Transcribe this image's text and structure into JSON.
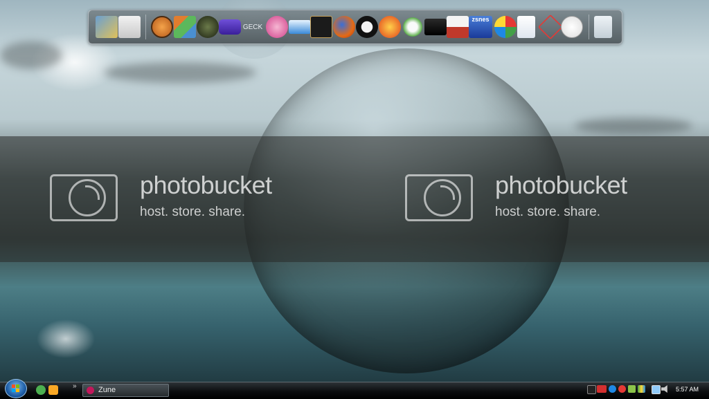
{
  "dock": {
    "geck_label": "GECK",
    "zsnes_label": "zsnes",
    "items": [
      "folder-icon",
      "presentation-icon",
      "half-life-icon",
      "mfc-icon",
      "alien-icon",
      "gameboy-advance-icon",
      "geck-icon",
      "pink-badge-icon",
      "m-logo-icon",
      "shuriken-icon",
      "firefox-icon",
      "eight-ball-icon",
      "p-app-icon",
      "flower-icon",
      "steam-icon",
      "famicom-icon",
      "zsnes-icon",
      "xbox-icon",
      "document-icon",
      "gem-icon",
      "clock-icon",
      "recycle-bin-icon"
    ]
  },
  "watermark": {
    "brand": "photobucket",
    "tagline": "host. store. share."
  },
  "taskbar": {
    "task_label": "Zune",
    "chevron": "»",
    "time": "5:57 AM"
  },
  "colors": {
    "taskbar": "#0b0d0f",
    "start_orb": "#1e5ea8",
    "zune": "#c2185b"
  }
}
